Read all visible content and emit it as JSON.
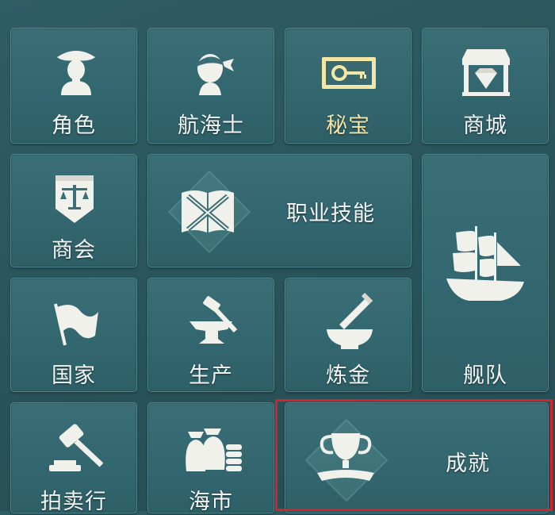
{
  "menu": {
    "items": [
      {
        "label": "角色",
        "icon": "pirate-captain-icon"
      },
      {
        "label": "航海士",
        "icon": "sailor-bandana-icon"
      },
      {
        "label": "秘宝",
        "icon": "treasure-key-icon"
      },
      {
        "label": "商城",
        "icon": "shop-gem-icon"
      },
      {
        "label": "商会",
        "icon": "guild-scales-icon"
      },
      {
        "label": "职业技能",
        "icon": "book-crossed-swords-icon"
      },
      {
        "label": "舰队",
        "icon": "sailing-ship-icon"
      },
      {
        "label": "国家",
        "icon": "flag-icon"
      },
      {
        "label": "生产",
        "icon": "anvil-hammer-icon"
      },
      {
        "label": "炼金",
        "icon": "mortar-pestle-icon"
      },
      {
        "label": "拍卖行",
        "icon": "gavel-icon"
      },
      {
        "label": "海市",
        "icon": "money-bags-coins-icon"
      },
      {
        "label": "成就",
        "icon": "trophy-icon"
      }
    ]
  },
  "colors": {
    "background": "#2a555c",
    "tile": "#336770",
    "label": "#f2f6f5",
    "label_gold": "#f3e6a6",
    "highlight": "#d2252b"
  }
}
